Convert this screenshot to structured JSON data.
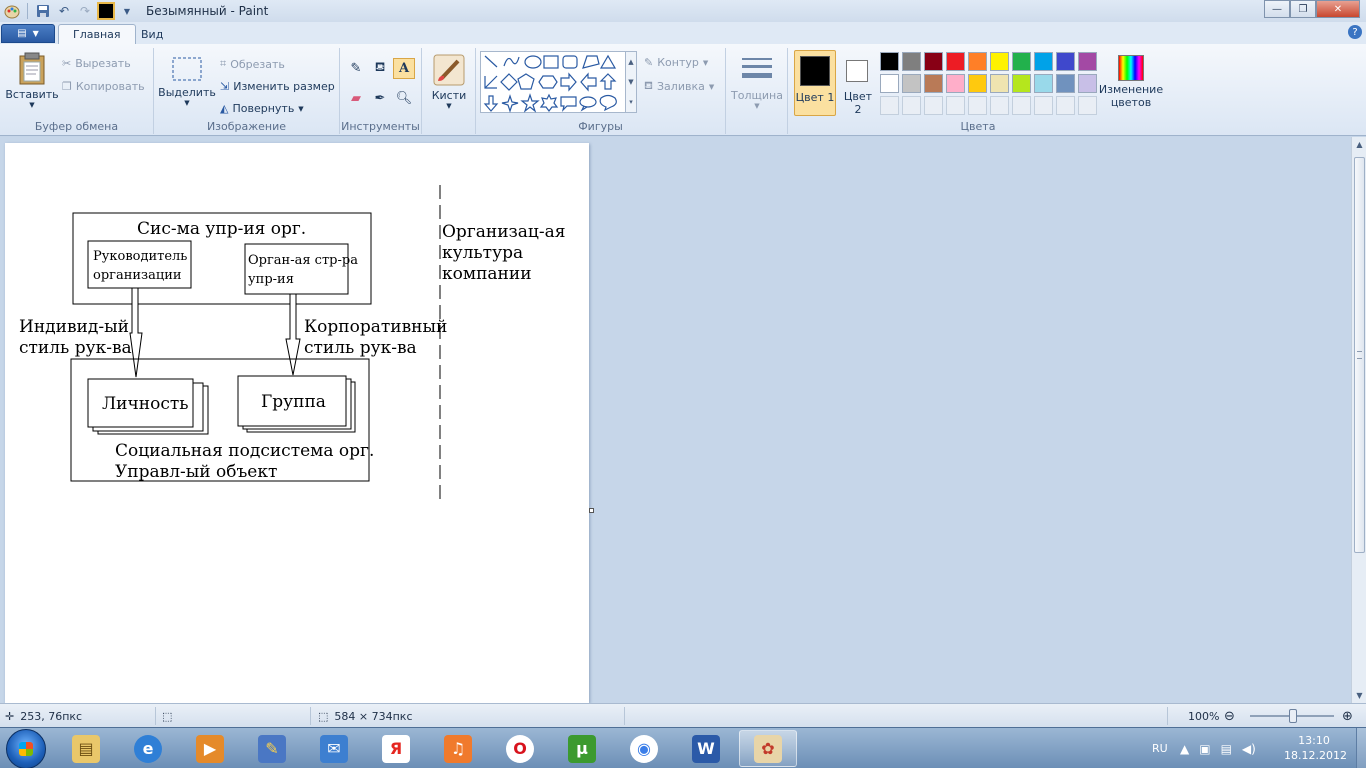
{
  "window": {
    "title": "Безымянный - Paint"
  },
  "tabs": {
    "file_menu_icon": "menu-icon",
    "home": "Главная",
    "view": "Вид"
  },
  "ribbon": {
    "clipboard": {
      "label": "Буфер обмена",
      "paste": "Вставить",
      "cut": "Вырезать",
      "copy": "Копировать"
    },
    "image": {
      "label": "Изображение",
      "select": "Выделить",
      "crop": "Обрезать",
      "resize": "Изменить размер",
      "rotate": "Повернуть"
    },
    "tools": {
      "label": "Инструменты"
    },
    "brushes": {
      "label": "Кисти"
    },
    "shapes": {
      "label": "Фигуры",
      "outline": "Контур",
      "fill": "Заливка"
    },
    "size": {
      "label": "Толщина"
    },
    "colors": {
      "label": "Цвета",
      "color1": "Цвет 1",
      "color2": "Цвет 2",
      "edit": "Изменение цветов",
      "color1_value": "#000000",
      "color2_value": "#ffffff",
      "palette_row1": [
        "#000000",
        "#7f7f7f",
        "#880015",
        "#ed1c24",
        "#ff7f27",
        "#fff200",
        "#22b14c",
        "#00a2e8",
        "#3f48cc",
        "#a349a4"
      ],
      "palette_row2": [
        "#ffffff",
        "#c3c3c3",
        "#b97a57",
        "#ffaec9",
        "#ffc90e",
        "#efe4b0",
        "#b5e61d",
        "#99d9ea",
        "#7092be",
        "#c8bfe7"
      ]
    }
  },
  "diagram": {
    "top_title": "Сис-ма упр-ия орг.",
    "leader": [
      "Руководитель",
      "организации"
    ],
    "structure": [
      "Орган-ая стр-ра",
      "упр-ия"
    ],
    "left_label": [
      "Индивид-ый",
      "стиль рук-ва"
    ],
    "right_label": [
      "Корпоративный",
      "стиль рук-ва"
    ],
    "person": "Личность",
    "group": "Группа",
    "bottom_title": [
      "Социальная подсистема орг.",
      "Управл-ый объект"
    ],
    "culture": [
      "Организац-ая",
      "культура",
      "компании"
    ]
  },
  "statusbar": {
    "cursor_pos": "253, 76пкс",
    "image_size": "584 × 734пкс",
    "zoom": "100%"
  },
  "taskbar": {
    "apps": [
      "explorer",
      "internet-explorer",
      "media-center",
      "program",
      "mail",
      "yandex",
      "music",
      "opera",
      "utorrent",
      "chrome",
      "word",
      "paint"
    ],
    "lang": "RU",
    "time": "13:10",
    "date": "18.12.2012"
  }
}
